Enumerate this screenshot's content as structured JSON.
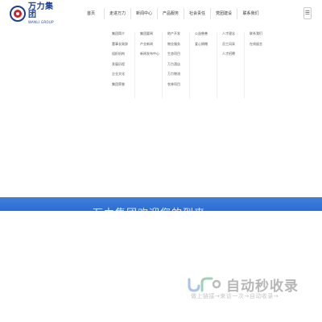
{
  "brand": {
    "name_cn": "万力集团",
    "name_en": "WANLI GROUP"
  },
  "nav": {
    "items": [
      {
        "label": "首页"
      },
      {
        "label": "走进万力"
      },
      {
        "label": "新闻中心"
      },
      {
        "label": "产品服务"
      },
      {
        "label": "社会责任"
      },
      {
        "label": "党团建设"
      },
      {
        "label": "联系我们"
      }
    ],
    "menu_icon": "hamburger-icon"
  },
  "dropdown": {
    "columns": [
      {
        "items": [
          "集团简介",
          "董事长致辞",
          "组织机构",
          "发展历程",
          "企业文化",
          "集团荣誉"
        ]
      },
      {
        "items": [
          "集团要闻",
          "产业新闻",
          "新闻发布中心"
        ]
      },
      {
        "items": [
          "地产开发",
          "物业服务",
          "生态项目",
          "万力酒店",
          "万力物流",
          "农林项目"
        ]
      },
      {
        "items": [
          "公益慈善",
          "爱心捐赠"
        ]
      },
      {
        "items": [
          "人才理念",
          "员工风采",
          "人才招聘"
        ]
      },
      {
        "items": [
          "联系我们",
          "在线留言"
        ]
      }
    ]
  },
  "hero": {
    "text": "万力集团欢迎您的到来"
  },
  "watermark": {
    "title": "自动秒收录",
    "subtitle": "做上链接→来访一次→自动收录→"
  },
  "colors": {
    "brand_blue": "#1f3f8f",
    "brand_red": "#c8262c",
    "hero_blue": "#3f7fdc",
    "watermark_grey": "#b7b7b7"
  }
}
